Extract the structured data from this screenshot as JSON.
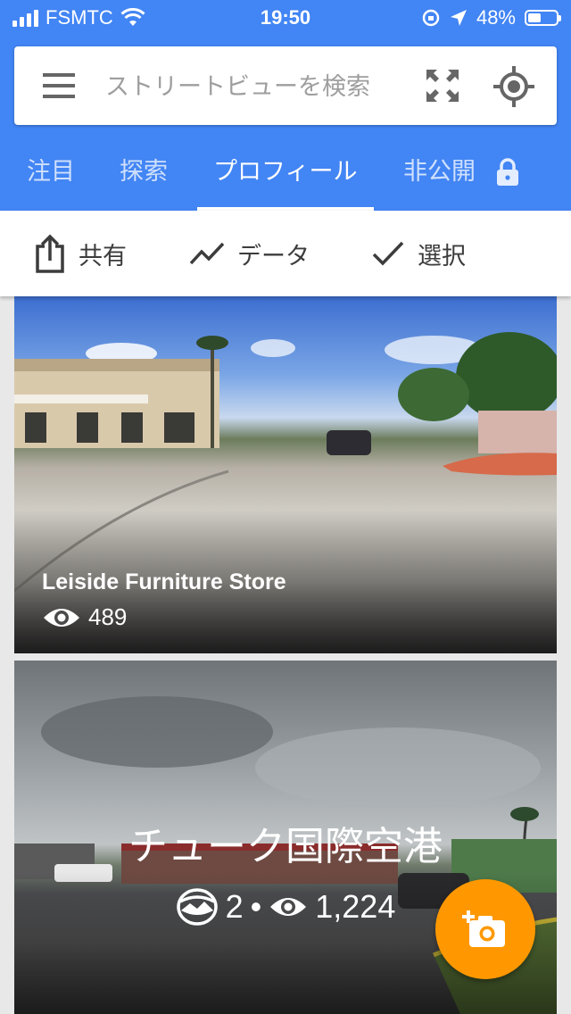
{
  "status_bar": {
    "carrier": "FSMTC",
    "time": "19:50",
    "battery": "48%",
    "battery_level": 0.48
  },
  "search": {
    "placeholder": "ストリートビューを検索"
  },
  "tabs": [
    {
      "label": "注目"
    },
    {
      "label": "探索"
    },
    {
      "label": "プロフィール",
      "active": true
    },
    {
      "label": "非公開"
    }
  ],
  "actions": {
    "share_label": "共有",
    "data_label": "データ",
    "select_label": "選択"
  },
  "cards": [
    {
      "title": "Leiside Furniture Store",
      "views": "489"
    },
    {
      "title": "チューク国際空港",
      "photos": "2",
      "separator": "•",
      "views": "1,224"
    }
  ],
  "colors": {
    "header_blue": "#4285f4",
    "fab_orange": "#ff9800"
  },
  "icons": [
    "menu-icon",
    "expand-icon",
    "my-location-icon",
    "lock-icon",
    "share-icon",
    "trending-icon",
    "check-icon",
    "eye-icon",
    "panorama-icon",
    "add-photo-icon"
  ]
}
